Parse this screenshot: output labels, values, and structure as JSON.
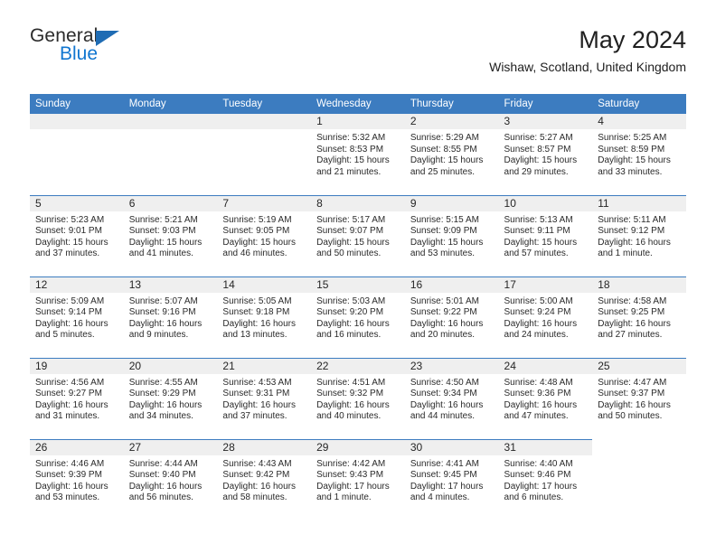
{
  "brand": {
    "name_top": "General",
    "name_bottom": "Blue",
    "triangle_color": "#1f6cb4",
    "blue_color": "#1176d0"
  },
  "header": {
    "title": "May 2024",
    "subtitle": "Wishaw, Scotland, United Kingdom"
  },
  "theme": {
    "header_bg": "#3c7cc0",
    "daynum_bg": "#efefef",
    "row_divider": "#3c7cc0"
  },
  "calendar": {
    "weekday_headers": [
      "Sunday",
      "Monday",
      "Tuesday",
      "Wednesday",
      "Thursday",
      "Friday",
      "Saturday"
    ],
    "weeks": [
      [
        {
          "empty": true
        },
        {
          "empty": true
        },
        {
          "empty": true
        },
        {
          "day": "1",
          "sunrise": "Sunrise: 5:32 AM",
          "sunset": "Sunset: 8:53 PM",
          "daylight1": "Daylight: 15 hours",
          "daylight2": "and 21 minutes."
        },
        {
          "day": "2",
          "sunrise": "Sunrise: 5:29 AM",
          "sunset": "Sunset: 8:55 PM",
          "daylight1": "Daylight: 15 hours",
          "daylight2": "and 25 minutes."
        },
        {
          "day": "3",
          "sunrise": "Sunrise: 5:27 AM",
          "sunset": "Sunset: 8:57 PM",
          "daylight1": "Daylight: 15 hours",
          "daylight2": "and 29 minutes."
        },
        {
          "day": "4",
          "sunrise": "Sunrise: 5:25 AM",
          "sunset": "Sunset: 8:59 PM",
          "daylight1": "Daylight: 15 hours",
          "daylight2": "and 33 minutes."
        }
      ],
      [
        {
          "day": "5",
          "sunrise": "Sunrise: 5:23 AM",
          "sunset": "Sunset: 9:01 PM",
          "daylight1": "Daylight: 15 hours",
          "daylight2": "and 37 minutes."
        },
        {
          "day": "6",
          "sunrise": "Sunrise: 5:21 AM",
          "sunset": "Sunset: 9:03 PM",
          "daylight1": "Daylight: 15 hours",
          "daylight2": "and 41 minutes."
        },
        {
          "day": "7",
          "sunrise": "Sunrise: 5:19 AM",
          "sunset": "Sunset: 9:05 PM",
          "daylight1": "Daylight: 15 hours",
          "daylight2": "and 46 minutes."
        },
        {
          "day": "8",
          "sunrise": "Sunrise: 5:17 AM",
          "sunset": "Sunset: 9:07 PM",
          "daylight1": "Daylight: 15 hours",
          "daylight2": "and 50 minutes."
        },
        {
          "day": "9",
          "sunrise": "Sunrise: 5:15 AM",
          "sunset": "Sunset: 9:09 PM",
          "daylight1": "Daylight: 15 hours",
          "daylight2": "and 53 minutes."
        },
        {
          "day": "10",
          "sunrise": "Sunrise: 5:13 AM",
          "sunset": "Sunset: 9:11 PM",
          "daylight1": "Daylight: 15 hours",
          "daylight2": "and 57 minutes."
        },
        {
          "day": "11",
          "sunrise": "Sunrise: 5:11 AM",
          "sunset": "Sunset: 9:12 PM",
          "daylight1": "Daylight: 16 hours",
          "daylight2": "and 1 minute."
        }
      ],
      [
        {
          "day": "12",
          "sunrise": "Sunrise: 5:09 AM",
          "sunset": "Sunset: 9:14 PM",
          "daylight1": "Daylight: 16 hours",
          "daylight2": "and 5 minutes."
        },
        {
          "day": "13",
          "sunrise": "Sunrise: 5:07 AM",
          "sunset": "Sunset: 9:16 PM",
          "daylight1": "Daylight: 16 hours",
          "daylight2": "and 9 minutes."
        },
        {
          "day": "14",
          "sunrise": "Sunrise: 5:05 AM",
          "sunset": "Sunset: 9:18 PM",
          "daylight1": "Daylight: 16 hours",
          "daylight2": "and 13 minutes."
        },
        {
          "day": "15",
          "sunrise": "Sunrise: 5:03 AM",
          "sunset": "Sunset: 9:20 PM",
          "daylight1": "Daylight: 16 hours",
          "daylight2": "and 16 minutes."
        },
        {
          "day": "16",
          "sunrise": "Sunrise: 5:01 AM",
          "sunset": "Sunset: 9:22 PM",
          "daylight1": "Daylight: 16 hours",
          "daylight2": "and 20 minutes."
        },
        {
          "day": "17",
          "sunrise": "Sunrise: 5:00 AM",
          "sunset": "Sunset: 9:24 PM",
          "daylight1": "Daylight: 16 hours",
          "daylight2": "and 24 minutes."
        },
        {
          "day": "18",
          "sunrise": "Sunrise: 4:58 AM",
          "sunset": "Sunset: 9:25 PM",
          "daylight1": "Daylight: 16 hours",
          "daylight2": "and 27 minutes."
        }
      ],
      [
        {
          "day": "19",
          "sunrise": "Sunrise: 4:56 AM",
          "sunset": "Sunset: 9:27 PM",
          "daylight1": "Daylight: 16 hours",
          "daylight2": "and 31 minutes."
        },
        {
          "day": "20",
          "sunrise": "Sunrise: 4:55 AM",
          "sunset": "Sunset: 9:29 PM",
          "daylight1": "Daylight: 16 hours",
          "daylight2": "and 34 minutes."
        },
        {
          "day": "21",
          "sunrise": "Sunrise: 4:53 AM",
          "sunset": "Sunset: 9:31 PM",
          "daylight1": "Daylight: 16 hours",
          "daylight2": "and 37 minutes."
        },
        {
          "day": "22",
          "sunrise": "Sunrise: 4:51 AM",
          "sunset": "Sunset: 9:32 PM",
          "daylight1": "Daylight: 16 hours",
          "daylight2": "and 40 minutes."
        },
        {
          "day": "23",
          "sunrise": "Sunrise: 4:50 AM",
          "sunset": "Sunset: 9:34 PM",
          "daylight1": "Daylight: 16 hours",
          "daylight2": "and 44 minutes."
        },
        {
          "day": "24",
          "sunrise": "Sunrise: 4:48 AM",
          "sunset": "Sunset: 9:36 PM",
          "daylight1": "Daylight: 16 hours",
          "daylight2": "and 47 minutes."
        },
        {
          "day": "25",
          "sunrise": "Sunrise: 4:47 AM",
          "sunset": "Sunset: 9:37 PM",
          "daylight1": "Daylight: 16 hours",
          "daylight2": "and 50 minutes."
        }
      ],
      [
        {
          "day": "26",
          "sunrise": "Sunrise: 4:46 AM",
          "sunset": "Sunset: 9:39 PM",
          "daylight1": "Daylight: 16 hours",
          "daylight2": "and 53 minutes."
        },
        {
          "day": "27",
          "sunrise": "Sunrise: 4:44 AM",
          "sunset": "Sunset: 9:40 PM",
          "daylight1": "Daylight: 16 hours",
          "daylight2": "and 56 minutes."
        },
        {
          "day": "28",
          "sunrise": "Sunrise: 4:43 AM",
          "sunset": "Sunset: 9:42 PM",
          "daylight1": "Daylight: 16 hours",
          "daylight2": "and 58 minutes."
        },
        {
          "day": "29",
          "sunrise": "Sunrise: 4:42 AM",
          "sunset": "Sunset: 9:43 PM",
          "daylight1": "Daylight: 17 hours",
          "daylight2": "and 1 minute."
        },
        {
          "day": "30",
          "sunrise": "Sunrise: 4:41 AM",
          "sunset": "Sunset: 9:45 PM",
          "daylight1": "Daylight: 17 hours",
          "daylight2": "and 4 minutes."
        },
        {
          "day": "31",
          "sunrise": "Sunrise: 4:40 AM",
          "sunset": "Sunset: 9:46 PM",
          "daylight1": "Daylight: 17 hours",
          "daylight2": "and 6 minutes."
        },
        {
          "blank": true
        }
      ]
    ]
  }
}
